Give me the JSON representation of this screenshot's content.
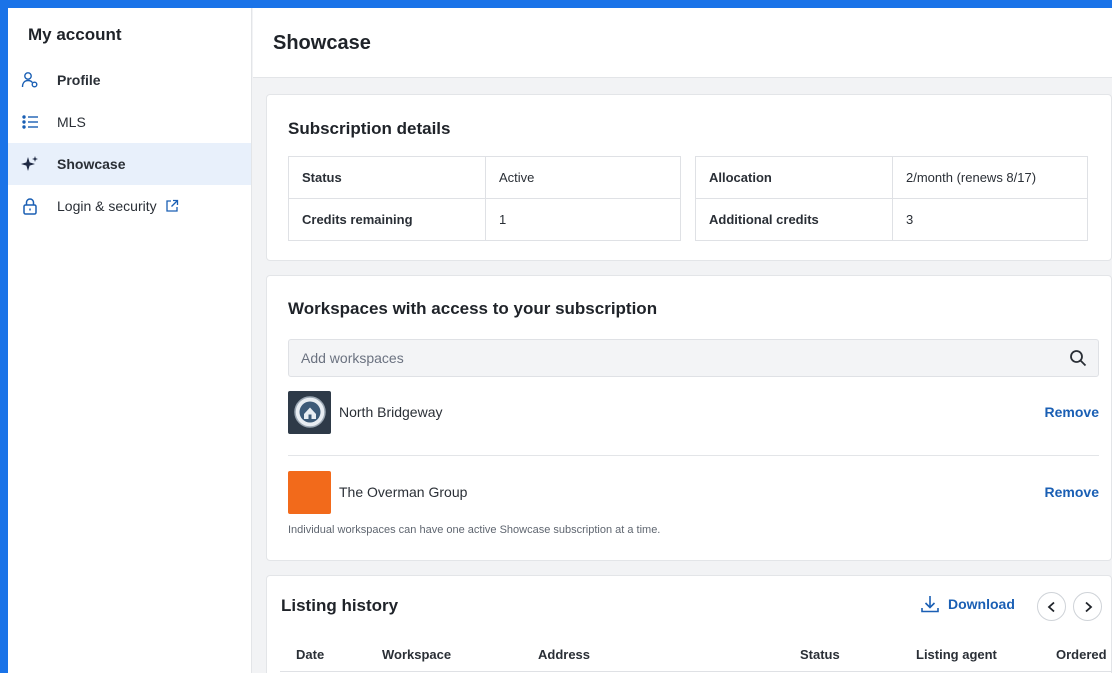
{
  "sidebar": {
    "title": "My account",
    "items": [
      {
        "label": "Profile",
        "icon": "user-badge-icon"
      },
      {
        "label": "MLS",
        "icon": "list-icon"
      },
      {
        "label": "Showcase",
        "icon": "sparkle-icon",
        "active": true
      },
      {
        "label": "Login & security",
        "icon": "lock-icon",
        "external": true
      }
    ]
  },
  "header": {
    "title": "Showcase"
  },
  "subscription": {
    "heading": "Subscription details",
    "left": [
      {
        "label": "Status",
        "value": "Active"
      },
      {
        "label": "Credits remaining",
        "value": "1"
      }
    ],
    "right": [
      {
        "label": "Allocation",
        "value": "2/month (renews 8/17)"
      },
      {
        "label": "Additional credits",
        "value": "3"
      }
    ]
  },
  "workspaces": {
    "heading": "Workspaces with access to your subscription",
    "search_placeholder": "Add workspaces",
    "items": [
      {
        "name": "North Bridgeway",
        "action": "Remove",
        "avatar_color": "#2e3a48"
      },
      {
        "name": "The Overman Group",
        "action": "Remove",
        "avatar_color": "#f26a1b"
      }
    ],
    "note": "Individual workspaces can have one active Showcase subscription at a time."
  },
  "history": {
    "heading": "Listing history",
    "download_label": "Download",
    "columns": [
      "Date",
      "Workspace",
      "Address",
      "Status",
      "Listing agent",
      "Ordered"
    ]
  },
  "colors": {
    "accent": "#1a5fb4",
    "active_bg": "#e8f0fb",
    "frame": "#1a73e8"
  }
}
